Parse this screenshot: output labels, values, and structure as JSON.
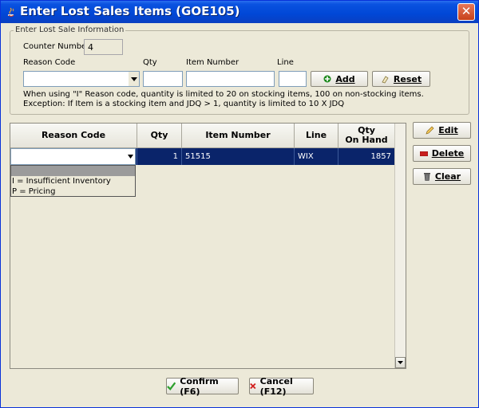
{
  "window": {
    "title": "Enter Lost Sales Items (GOE105)",
    "close_glyph": "✕"
  },
  "form": {
    "group_title": "Enter Lost Sale Information",
    "counter_label": "Counter Number:",
    "counter_value": "4",
    "reason_code_label": "Reason Code",
    "qty_label": "Qty",
    "item_number_label": "Item Number",
    "line_label": "Line",
    "add_button": "Add",
    "reset_button": "Reset",
    "note_line1": "When using \"I\" Reason code, quantity is limited to 20 on stocking items, 100 on non-stocking items.",
    "note_line2": "Exception: If Item is a stocking item and JDQ > 1, quantity is limited to 10 X JDQ"
  },
  "grid": {
    "columns": [
      "Reason Code",
      "Qty",
      "Item Number",
      "Line",
      "Qty On Hand"
    ],
    "qty_on_hand_line1": "Qty",
    "qty_on_hand_line2": "On Hand",
    "rows": [
      {
        "reason_code": "",
        "qty": "1",
        "item_number": "51515",
        "line": "WIX",
        "qty_on_hand": "1857"
      }
    ],
    "dropdown_options": [
      "",
      "I = Insufficient Inventory",
      "P = Pricing"
    ]
  },
  "side_buttons": {
    "edit": "Edit",
    "delete": "Delete",
    "clear": "Clear"
  },
  "footer": {
    "confirm": "Confirm (F6)",
    "cancel": "Cancel (F12)"
  },
  "colors": {
    "title_bar": "#0047d6",
    "selected_row": "#0a246a",
    "confirm_icon": "#2ea02e",
    "cancel_icon": "#d22020",
    "delete_icon": "#c81e1e"
  }
}
